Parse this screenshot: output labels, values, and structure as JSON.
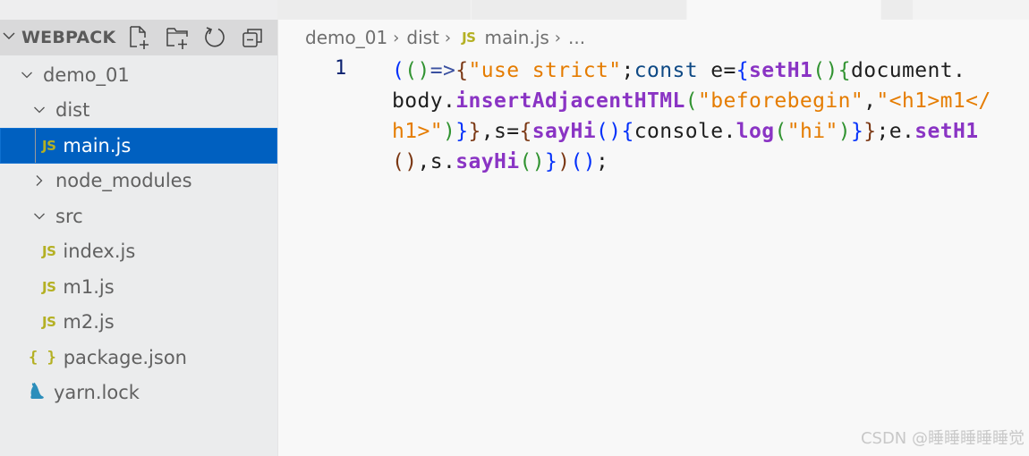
{
  "tabstrip": {
    "tabs": [
      {
        "label": "",
        "active": false
      },
      {
        "label": "",
        "active": false
      },
      {
        "label": "",
        "active": true
      },
      {
        "label": "",
        "active": false
      }
    ]
  },
  "explorer": {
    "section_title": "WEBPACK",
    "actions": [
      {
        "name": "new-file",
        "icon": "new-file-icon"
      },
      {
        "name": "new-folder",
        "icon": "new-folder-icon"
      },
      {
        "name": "refresh",
        "icon": "refresh-icon"
      },
      {
        "name": "collapse-all",
        "icon": "collapse-all-icon"
      }
    ],
    "tree": [
      {
        "label": "demo_01",
        "type": "folder",
        "expanded": true,
        "depth": 0
      },
      {
        "label": "dist",
        "type": "folder",
        "expanded": true,
        "depth": 1
      },
      {
        "label": "main.js",
        "type": "js",
        "depth": 2,
        "selected": true
      },
      {
        "label": "node_modules",
        "type": "folder",
        "expanded": false,
        "depth": 1
      },
      {
        "label": "src",
        "type": "folder",
        "expanded": true,
        "depth": 1
      },
      {
        "label": "index.js",
        "type": "js",
        "depth": 2
      },
      {
        "label": "m1.js",
        "type": "js",
        "depth": 2
      },
      {
        "label": "m2.js",
        "type": "js",
        "depth": 2
      },
      {
        "label": "package.json",
        "type": "json",
        "depth": 1
      },
      {
        "label": "yarn.lock",
        "type": "yarn",
        "depth": 1
      }
    ],
    "js_badge": "JS",
    "json_badge": "{ }"
  },
  "breadcrumb": {
    "items": [
      "demo_01",
      "dist",
      "main.js",
      "..."
    ],
    "js_badge": "JS"
  },
  "editor": {
    "line_number": "1",
    "wrapped_lines": [
      [
        [
          "b1",
          "("
        ],
        [
          "b2",
          "("
        ],
        [
          "b2",
          ")"
        ],
        [
          "op",
          "=>"
        ],
        [
          "b3",
          "{"
        ],
        [
          "str",
          "\"use strict\""
        ],
        [
          "plain",
          ";"
        ],
        [
          "kw",
          "const"
        ],
        [
          "plain",
          " e="
        ],
        [
          "b1",
          "{"
        ],
        [
          "fn",
          "setH1"
        ],
        [
          "b2",
          "("
        ],
        [
          "b2",
          ")"
        ],
        [
          "b2",
          "{"
        ],
        [
          "plain",
          "document."
        ]
      ],
      [
        [
          "plain",
          "body."
        ],
        [
          "fn",
          "insertAdjacentHTML"
        ],
        [
          "b2",
          "("
        ],
        [
          "str",
          "\"beforebegin\""
        ],
        [
          "plain",
          ","
        ],
        [
          "str",
          "\"<h1>m1</"
        ]
      ],
      [
        [
          "str",
          "h1>\""
        ],
        [
          "b2",
          ")"
        ],
        [
          "b1",
          "}"
        ],
        [
          "b3",
          "}"
        ],
        [
          "plain",
          ",s="
        ],
        [
          "b3",
          "{"
        ],
        [
          "fn",
          "sayHi"
        ],
        [
          "b1",
          "("
        ],
        [
          "b1",
          ")"
        ],
        [
          "b1",
          "{"
        ],
        [
          "plain",
          "console."
        ],
        [
          "fn",
          "log"
        ],
        [
          "b2",
          "("
        ],
        [
          "str",
          "\"hi\""
        ],
        [
          "b2",
          ")"
        ],
        [
          "b1",
          "}"
        ],
        [
          "b3",
          "}"
        ],
        [
          "plain",
          ";e."
        ],
        [
          "fn",
          "setH1"
        ]
      ],
      [
        [
          "b3",
          "("
        ],
        [
          "b3",
          ")"
        ],
        [
          "plain",
          ",s."
        ],
        [
          "fn",
          "sayHi"
        ],
        [
          "b2",
          "("
        ],
        [
          "b2",
          ")"
        ],
        [
          "b1",
          "}"
        ],
        [
          "b3",
          ")"
        ],
        [
          "b1",
          "("
        ],
        [
          "b1",
          ")"
        ],
        [
          "plain",
          ";"
        ]
      ]
    ]
  },
  "watermark": "CSDN @睡睡睡睡睡觉"
}
